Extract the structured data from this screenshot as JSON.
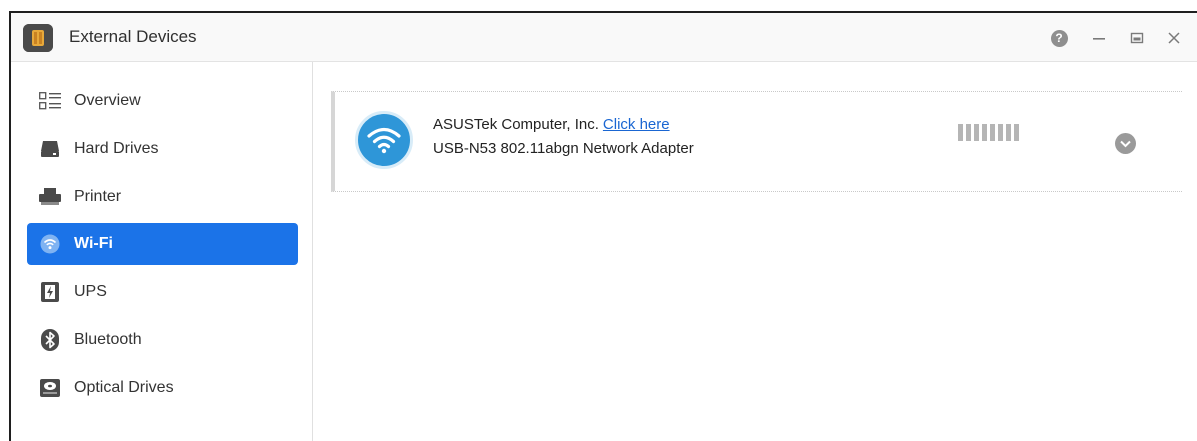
{
  "window": {
    "title": "External Devices",
    "controls": {
      "help": "?",
      "minimize": "—",
      "maximize": "□",
      "close": "×"
    }
  },
  "sidebar": {
    "items": [
      {
        "label": "Overview",
        "icon": "overview-list-icon",
        "active": false
      },
      {
        "label": "Hard Drives",
        "icon": "hard-drive-icon",
        "active": false
      },
      {
        "label": "Printer",
        "icon": "printer-icon",
        "active": false
      },
      {
        "label": "Wi-Fi",
        "icon": "wifi-icon",
        "active": true
      },
      {
        "label": "UPS",
        "icon": "ups-battery-icon",
        "active": false
      },
      {
        "label": "Bluetooth",
        "icon": "bluetooth-icon",
        "active": false
      },
      {
        "label": "Optical Drives",
        "icon": "optical-drive-icon",
        "active": false
      }
    ]
  },
  "device": {
    "vendor": "ASUSTek Computer, Inc.",
    "link_text": "Click here",
    "model": "USB-N53 802.11abgn Network Adapter",
    "icon": "wifi-icon",
    "signal_bars_total": 8,
    "signal_bars_active": 0
  },
  "colors": {
    "accent": "#1b73e8",
    "wifi_badge": "#2e96d8",
    "link": "#1a66d2"
  }
}
